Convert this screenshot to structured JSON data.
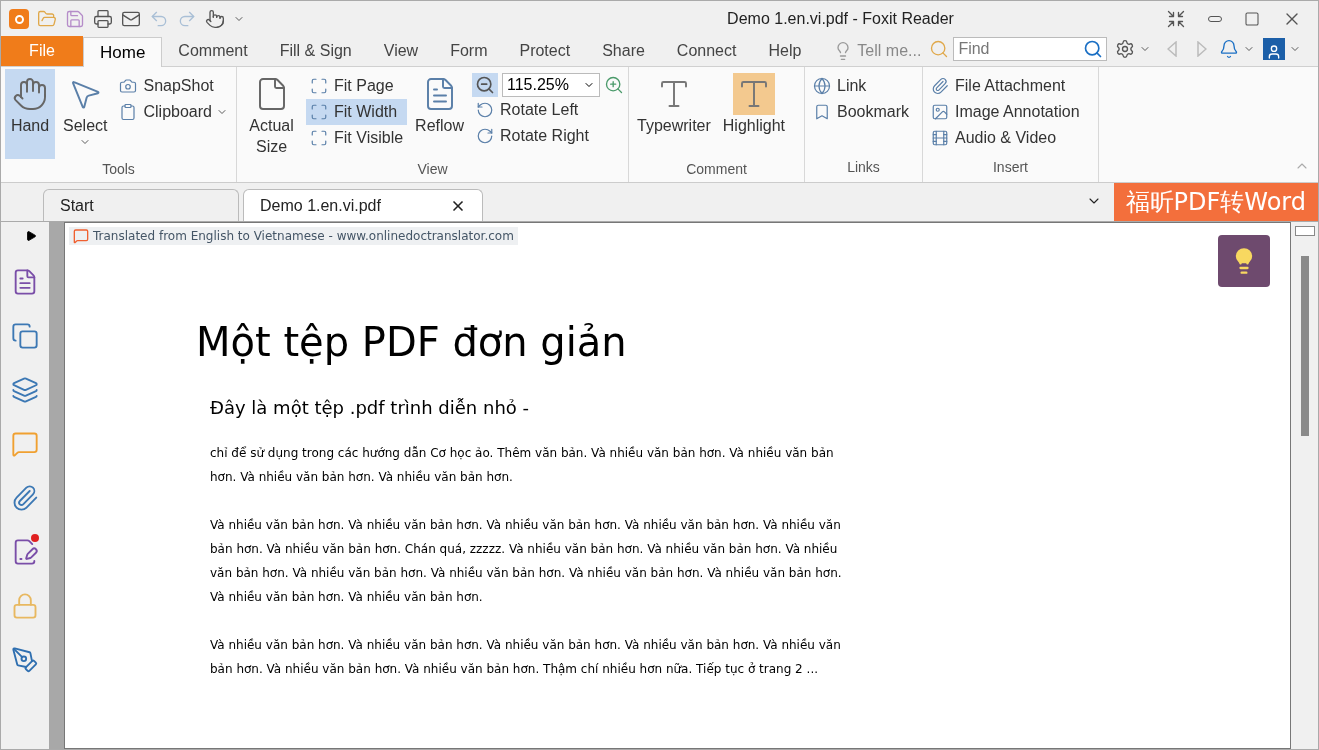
{
  "window": {
    "title": "Demo 1.en.vi.pdf - Foxit Reader"
  },
  "file_menu": "File",
  "ribbon_tabs": [
    {
      "label": "Home",
      "selected": true
    },
    {
      "label": "Comment",
      "selected": false
    },
    {
      "label": "Fill & Sign",
      "selected": false
    },
    {
      "label": "View",
      "selected": false
    },
    {
      "label": "Form",
      "selected": false
    },
    {
      "label": "Protect",
      "selected": false
    },
    {
      "label": "Share",
      "selected": false
    },
    {
      "label": "Connect",
      "selected": false
    },
    {
      "label": "Help",
      "selected": false
    }
  ],
  "tell_me": "Tell me...",
  "search": {
    "placeholder": "Find"
  },
  "ribbon": {
    "tools": {
      "label": "Tools",
      "hand": {
        "label": "Hand",
        "selected": true
      },
      "select": {
        "label": "Select",
        "selected": false
      },
      "snapshot": "SnapShot",
      "clipboard": "Clipboard"
    },
    "view": {
      "label": "View",
      "actual_size": "Actual Size",
      "fit": [
        {
          "label": "Fit Page",
          "selected": false
        },
        {
          "label": "Fit Width",
          "selected": true
        },
        {
          "label": "Fit Visible",
          "selected": false
        }
      ],
      "reflow": "Reflow",
      "zoom_value": "115.25%",
      "rotate_left": "Rotate Left",
      "rotate_right": "Rotate Right"
    },
    "comment": {
      "label": "Comment",
      "typewriter": "Typewriter",
      "highlight": "Highlight"
    },
    "links": {
      "label": "Links",
      "link": "Link",
      "bookmark": "Bookmark"
    },
    "insert": {
      "label": "Insert",
      "items": [
        "File Attachment",
        "Image Annotation",
        "Audio & Video"
      ]
    }
  },
  "doc_tabs": [
    {
      "label": "Start",
      "selected": false
    },
    {
      "label": "Demo 1.en.vi.pdf",
      "selected": true
    }
  ],
  "promo_banner": "福昕PDF转Word",
  "document": {
    "translation_notice": "Translated from English to Vietnamese - www.onlinedoctranslator.com",
    "title": "Một tệp PDF đơn giản",
    "subtitle": "Đây là một tệp .pdf trình diễn nhỏ -",
    "paragraphs": [
      "chỉ để sử dụng trong các hướng dẫn Cơ học ảo. Thêm văn bản. Và nhiều văn bản hơn. Và nhiều văn bản hơn. Và nhiều văn bản hơn. Và nhiều văn bản hơn.",
      "Và nhiều văn bản hơn. Và nhiều văn bản hơn. Và nhiều văn bản hơn. Và nhiều văn bản hơn. Và nhiều văn bản hơn. Và nhiều văn bản hơn. Chán quá, zzzzz. Và nhiều văn bản hơn. Và nhiều văn bản hơn. Và nhiều văn bản hơn. Và nhiều văn bản hơn. Và nhiều văn bản hơn. Và nhiều văn bản hơn. Và nhiều văn bản hơn. Và nhiều văn bản hơn. Và nhiều văn bản hơn.",
      "Và nhiều văn bản hơn. Và nhiều văn bản hơn. Và nhiều văn bản hơn. Và nhiều văn bản hơn. Và nhiều văn bản hơn. Và nhiều văn bản hơn. Và nhiều văn bản hơn. Thậm chí nhiều hơn nữa. Tiếp tục ở trang 2 ..."
    ]
  }
}
